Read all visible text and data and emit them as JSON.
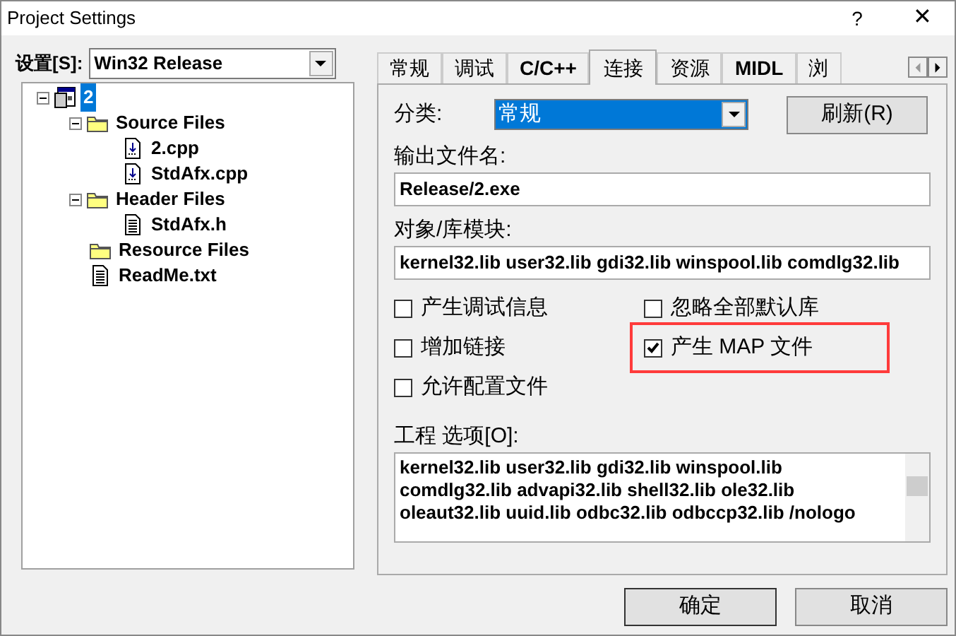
{
  "window": {
    "title": "Project Settings",
    "buttons": [
      "?",
      "✕"
    ]
  },
  "settings": {
    "label": "设置[S]:",
    "value": "Win32 Release"
  },
  "tree": [
    {
      "label": "2",
      "kind": "project",
      "selected": true,
      "expanded": true,
      "children": [
        {
          "label": "Source Files",
          "kind": "folder",
          "selected": false,
          "expanded": true,
          "children": [
            {
              "label": "2.cpp",
              "kind": "source",
              "selected": false
            },
            {
              "label": "StdAfx.cpp",
              "kind": "source",
              "selected": false
            }
          ]
        },
        {
          "label": "Header Files",
          "kind": "folder",
          "selected": false,
          "expanded": true,
          "children": [
            {
              "label": "StdAfx.h",
              "kind": "text",
              "selected": false
            }
          ]
        },
        {
          "label": "Resource Files",
          "kind": "folder",
          "selected": false
        },
        {
          "label": "ReadMe.txt",
          "kind": "text",
          "selected": false
        }
      ]
    }
  ],
  "tabs": [
    {
      "label": "常规",
      "selected": false
    },
    {
      "label": "调试",
      "selected": false
    },
    {
      "label": "C/C++",
      "selected": false
    },
    {
      "label": "连接",
      "selected": true
    },
    {
      "label": "资源",
      "selected": false
    },
    {
      "label": "MIDL",
      "selected": false
    },
    {
      "label": "浏",
      "selected": false
    }
  ],
  "category": {
    "label": "分类:",
    "value": "常规",
    "button": "刷新(R)"
  },
  "output": {
    "label": "输出文件名:",
    "value": "Release/2.exe"
  },
  "modules": {
    "label": "对象/库模块:",
    "value": "kernel32.lib user32.lib gdi32.lib winspool.lib comdlg32.lib"
  },
  "checkboxes": [
    {
      "label": "产生调试信息",
      "checked": false,
      "highlighted": false
    },
    {
      "label": "忽略全部默认库",
      "checked": false,
      "highlighted": false
    },
    {
      "label": "增加链接",
      "checked": false,
      "highlighted": false
    },
    {
      "label": "产生 MAP 文件",
      "checked": true,
      "highlighted": true
    },
    {
      "label": "允许配置文件",
      "checked": false,
      "highlighted": false
    }
  ],
  "project_options": {
    "label": "工程 选项[O]:",
    "lines": [
      "kernel32.lib user32.lib gdi32.lib winspool.lib",
      "comdlg32.lib advapi32.lib shell32.lib ole32.lib",
      "oleaut32.lib uuid.lib odbc32.lib odbccp32.lib /nologo"
    ]
  },
  "buttons": [
    "确定",
    "取消"
  ]
}
